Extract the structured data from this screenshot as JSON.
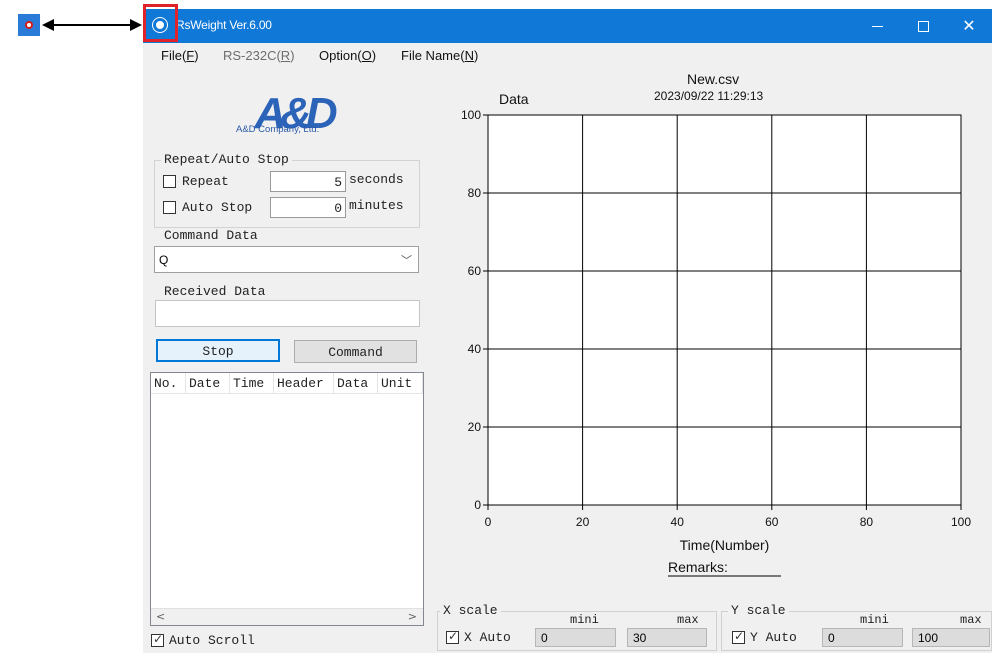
{
  "window": {
    "title": "RsWeight Ver.6.00",
    "titlebar_color": "#1078d7",
    "highlight_color": "#e0232b"
  },
  "menu": {
    "items": [
      {
        "label": "File(F)",
        "enabled": true
      },
      {
        "label": "RS-232C(R)",
        "enabled": false
      },
      {
        "label": "Option(O)",
        "enabled": true
      },
      {
        "label": "File Name(N)",
        "enabled": true
      }
    ]
  },
  "logo": {
    "brand": "A&D",
    "company": "A&D Company, Ltd."
  },
  "repeat_group": {
    "legend": "Repeat/Auto Stop",
    "repeat_label": "Repeat",
    "repeat_value": "5",
    "repeat_unit": "seconds",
    "auto_stop_label": "Auto Stop",
    "auto_stop_value": "0",
    "auto_stop_unit": "minutes"
  },
  "command": {
    "label": "Command Data",
    "selected": "Q"
  },
  "received": {
    "label": "Received Data",
    "value": ""
  },
  "buttons": {
    "stop": "Stop",
    "command": "Command"
  },
  "table": {
    "columns": [
      "No.",
      "Date",
      "Time",
      "Header",
      "Data",
      "Unit"
    ],
    "rows": []
  },
  "auto_scroll": {
    "label": "Auto Scroll",
    "checked": true
  },
  "chart_info": {
    "filename": "New.csv",
    "timestamp": "2023/09/22 11:29:13",
    "remarks": "Remarks:"
  },
  "chart_data": {
    "type": "line",
    "title": "Data",
    "xlabel": "Time(Number)",
    "ylabel": "",
    "xlim": [
      0,
      100
    ],
    "ylim": [
      0,
      100
    ],
    "xticks": [
      "0",
      "20",
      "40",
      "60",
      "80",
      "100"
    ],
    "yticks": [
      "0",
      "20",
      "40",
      "60",
      "80",
      "100"
    ],
    "grid": true,
    "series": []
  },
  "x_scale": {
    "legend": "X scale",
    "auto_label": "X Auto",
    "auto_checked": true,
    "mini_label": "mini",
    "max_label": "max",
    "mini_value": "0",
    "max_value": "30"
  },
  "y_scale": {
    "legend": "Y scale",
    "auto_label": "Y Auto",
    "auto_checked": true,
    "mini_label": "mini",
    "max_label": "max",
    "mini_value": "0",
    "max_value": "100"
  }
}
